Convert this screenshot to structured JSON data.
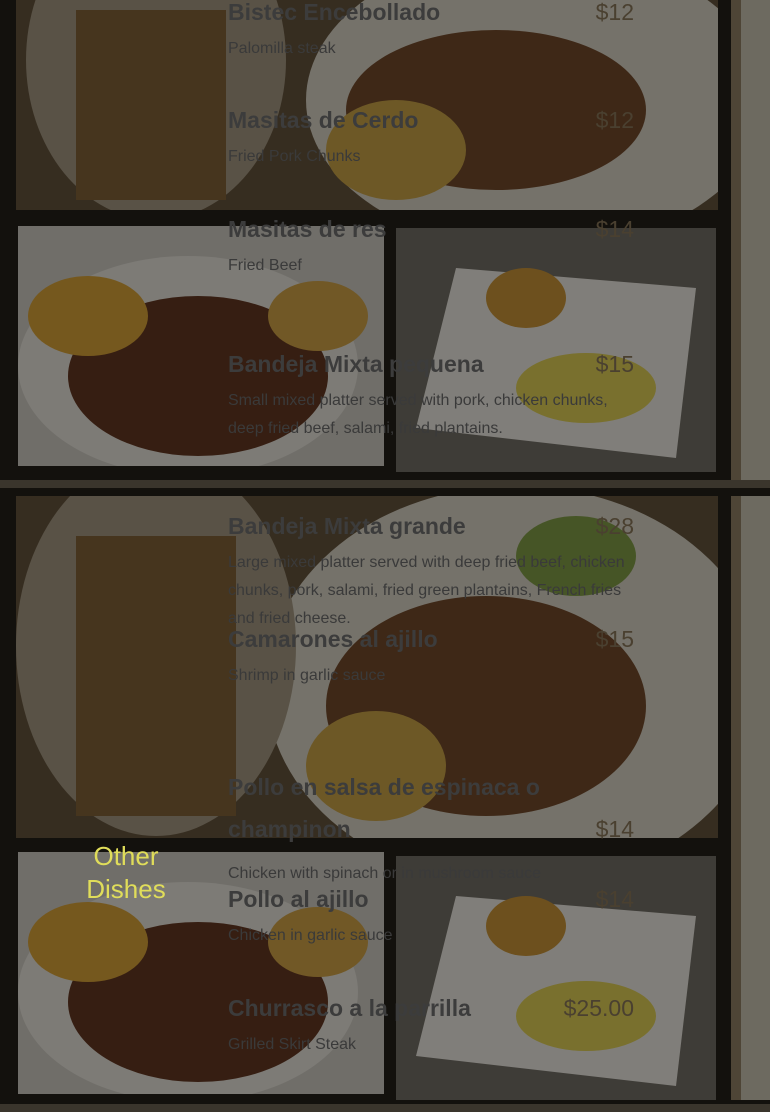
{
  "sections": [
    {
      "items": [
        {
          "name": "Bistec Encebollado",
          "price": "$12",
          "desc": "Palomilla steak"
        },
        {
          "name": "Masitas de Cerdo",
          "price": "$12",
          "desc": "Fried Pork Chunks"
        },
        {
          "name": "Masitas de res",
          "price": "$14",
          "desc": "Fried Beef"
        },
        {
          "name": "Bandeja Mixta pequena",
          "price": "$15",
          "desc": "Small mixed platter served with pork, chicken chunks, deep fried beef, salami, fried plantains."
        }
      ]
    },
    {
      "title": "Other Dishes",
      "items": [
        {
          "name": "Bandeja Mixta grande",
          "price": "$28",
          "desc": "Large mixed platter served with deep fried beef, chicken chunks, pork, salami, fried green plantains, French fries and fried cheese."
        },
        {
          "name": "Camarones al ajillo",
          "price": "$15",
          "desc": "Shrimp in garlic sauce"
        },
        {
          "name": "Pollo en salsa de espinaca o champinon",
          "price": "$14",
          "desc": "Chicken with spinach or in mushroom sauce"
        },
        {
          "name": "Pollo al ajillo",
          "price": "$14",
          "desc": "Chicken in garlic sauce"
        },
        {
          "name": "Churrasco a la parrilla",
          "price": "$25.00",
          "desc": "Grilled Skirt Steak"
        }
      ]
    }
  ],
  "colors": {
    "background": "#15130f",
    "item_name": "#3c3c3c",
    "price": "#4a4030",
    "title_accent": "#e0dd5a"
  }
}
